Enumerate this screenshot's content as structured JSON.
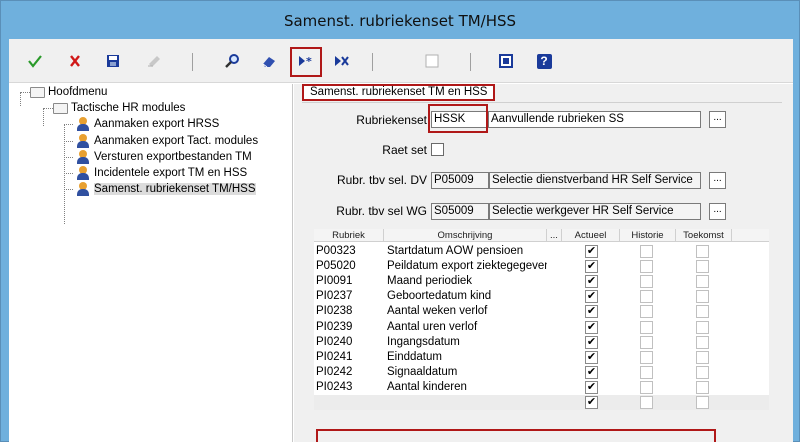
{
  "window": {
    "title": "Samenst. rubriekenset TM/HSS"
  },
  "toolbar": {
    "icons": [
      "check-icon",
      "cancel-icon",
      "save-icon",
      "edit-icon",
      "search-icon",
      "eraser-icon",
      "new-record-icon",
      "delete-record-icon",
      "blank-icon",
      "form-icon",
      "help-icon"
    ],
    "help_label": "?"
  },
  "tree": {
    "items": [
      {
        "label": "Hoofdmenu"
      },
      {
        "label": "Tactische HR modules"
      },
      {
        "label": "Aanmaken export HRSS"
      },
      {
        "label": "Aanmaken export Tact. modules"
      },
      {
        "label": "Versturen exportbestanden TM"
      },
      {
        "label": "Incidentele export TM en HSS"
      },
      {
        "label": "Samenst. rubriekenset TM/HSS"
      }
    ]
  },
  "panel": {
    "tab_label": "Samenst. rubriekenset TM en HSS",
    "rubriekenset": {
      "label": "Rubriekenset",
      "code": "HSSK",
      "description": "Aanvullende rubrieken SS",
      "button": "..."
    },
    "raet_set": {
      "label": "Raet set",
      "checked": false
    },
    "sel_dv": {
      "label": "Rubr. tbv sel. DV",
      "code": "P05009",
      "description": "Selectie dienstverband HR Self Service",
      "button": "..."
    },
    "sel_wg": {
      "label": "Rubr. tbv sel WG",
      "code": "S05009",
      "description": "Selectie werkgever HR Self Service",
      "button": "..."
    }
  },
  "grid": {
    "columns": [
      "Rubriek",
      "Omschrijving",
      "...",
      "Actueel",
      "Historie",
      "Toekomst"
    ],
    "rows": [
      {
        "rubriek": "P00323",
        "omschrijving": "Startdatum AOW pensioen",
        "actueel": true,
        "historie": false,
        "toekomst": false
      },
      {
        "rubriek": "P05020",
        "omschrijving": "Peildatum export ziektegegevens",
        "actueel": true,
        "historie": false,
        "toekomst": false
      },
      {
        "rubriek": "PI0091",
        "omschrijving": "Maand periodiek",
        "actueel": true,
        "historie": false,
        "toekomst": false
      },
      {
        "rubriek": "PI0237",
        "omschrijving": "Geboortedatum kind",
        "actueel": true,
        "historie": false,
        "toekomst": false
      },
      {
        "rubriek": "PI0238",
        "omschrijving": "Aantal weken verlof",
        "actueel": true,
        "historie": false,
        "toekomst": false
      },
      {
        "rubriek": "PI0239",
        "omschrijving": "Aantal uren verlof",
        "actueel": true,
        "historie": false,
        "toekomst": false
      },
      {
        "rubriek": "PI0240",
        "omschrijving": "Ingangsdatum",
        "actueel": true,
        "historie": false,
        "toekomst": false
      },
      {
        "rubriek": "PI0241",
        "omschrijving": "Einddatum",
        "actueel": true,
        "historie": false,
        "toekomst": false
      },
      {
        "rubriek": "PI0242",
        "omschrijving": "Signaaldatum",
        "actueel": true,
        "historie": false,
        "toekomst": false
      },
      {
        "rubriek": "PI0243",
        "omschrijving": "Aantal kinderen",
        "actueel": true,
        "historie": false,
        "toekomst": false
      },
      {
        "rubriek": "",
        "omschrijving": "",
        "actueel": true,
        "historie": false,
        "toekomst": false
      }
    ],
    "check_glyph": "✔"
  },
  "colors": {
    "accent": "#b01818",
    "titlebar": "#6fb0dd"
  }
}
